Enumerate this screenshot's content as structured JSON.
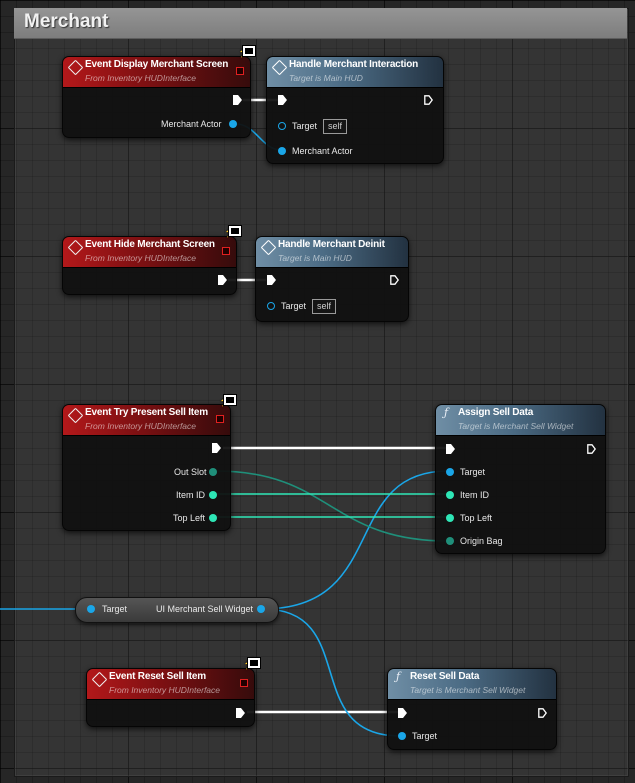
{
  "comment": {
    "title": "Merchant"
  },
  "nodes": {
    "display_event": {
      "title": "Event Display Merchant Screen",
      "subtitle": "From Inventory HUDInterface",
      "pin_out": "Merchant Actor"
    },
    "handle_interaction": {
      "title": "Handle Merchant Interaction",
      "subtitle": "Target is Main HUD",
      "pin_target": "Target",
      "self_value": "self",
      "pin_actor": "Merchant Actor"
    },
    "hide_event": {
      "title": "Event Hide Merchant Screen",
      "subtitle": "From Inventory HUDInterface"
    },
    "handle_deinit": {
      "title": "Handle Merchant Deinit",
      "subtitle": "Target is Main HUD",
      "pin_target": "Target",
      "self_value": "self"
    },
    "present_event": {
      "title": "Event Try Present Sell Item",
      "subtitle": "From Inventory HUDInterface",
      "pin_out_slot": "Out Slot",
      "pin_item_id": "Item ID",
      "pin_top_left": "Top Left"
    },
    "assign_sell": {
      "title": "Assign Sell Data",
      "subtitle": "Target is Merchant Sell Widget",
      "pin_target": "Target",
      "pin_item_id": "Item ID",
      "pin_top_left": "Top Left",
      "pin_origin_bag": "Origin Bag"
    },
    "variable_get": {
      "pin_target": "Target",
      "label": "UI Merchant Sell Widget"
    },
    "reset_event": {
      "title": "Event Reset Sell Item",
      "subtitle": "From Inventory HUDInterface"
    },
    "reset_sell": {
      "title": "Reset Sell Data",
      "subtitle": "Target is Merchant Sell Widget",
      "pin_target": "Target"
    }
  },
  "colors": {
    "event_header": "#b3181a",
    "function_header": "#6f8ea5",
    "object_pin": "#1aa6e8",
    "int_pin": "#2ee6b6",
    "struct_pin": "#1f8f7a",
    "exec_wire": "#ffffff"
  },
  "icons": [
    "event-diamond-icon",
    "function-f-icon",
    "replicated-square-icon",
    "client-monitor-icon",
    "exec-pin-icon"
  ]
}
